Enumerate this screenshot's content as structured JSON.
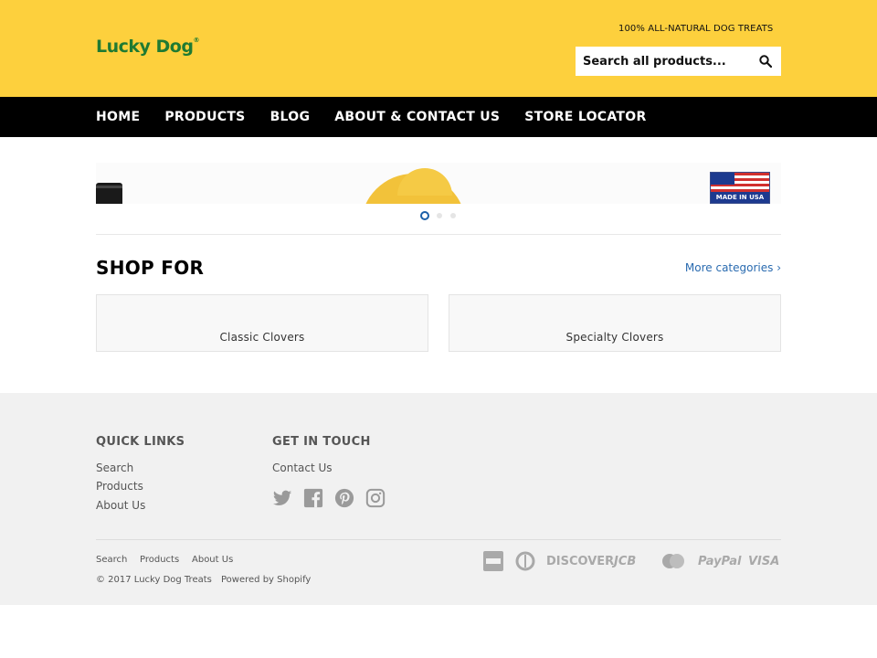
{
  "header": {
    "logo_text": "Lucky Dog",
    "logo_mark": "®",
    "tagline": "100% ALL-NATURAL DOG TREATS",
    "search_placeholder": "Search all products...",
    "background_color": "#fdd03d",
    "logo_color": "#1f7a32"
  },
  "nav": {
    "items": [
      {
        "label": "HOME"
      },
      {
        "label": "PRODUCTS"
      },
      {
        "label": "BLOG"
      },
      {
        "label": "ABOUT & CONTACT US"
      },
      {
        "label": "STORE LOCATOR"
      }
    ]
  },
  "slider": {
    "badge_text": "MADE IN USA",
    "active_slide": 1,
    "slide_count": 3,
    "accent_color": "#1b5fa8"
  },
  "shop": {
    "title": "SHOP FOR",
    "more_link": "More categories ›",
    "categories": [
      {
        "label": "Classic Clovers"
      },
      {
        "label": "Specialty Clovers"
      }
    ]
  },
  "footer": {
    "quick_links": {
      "heading": "QUICK LINKS",
      "items": [
        "Search",
        "Products",
        "About Us"
      ]
    },
    "get_in_touch": {
      "heading": "GET IN TOUCH",
      "contact": "Contact Us",
      "social_icons": [
        "twitter-icon",
        "facebook-icon",
        "pinterest-icon",
        "instagram-icon"
      ]
    },
    "bottom_links": [
      "Search",
      "Products",
      "About Us"
    ],
    "copyright": "© 2017 Lucky Dog Treats",
    "powered_by": "Powered by Shopify",
    "payment_icons": [
      "amex-icon",
      "diners-icon",
      "discover-icon",
      "jcb-icon",
      "mastercard-icon",
      "paypal-icon",
      "visa-icon"
    ],
    "payment_labels": {
      "discover": "DISCOVER",
      "jcb": "JCB",
      "paypal": "PayPal",
      "visa": "VISA"
    }
  }
}
